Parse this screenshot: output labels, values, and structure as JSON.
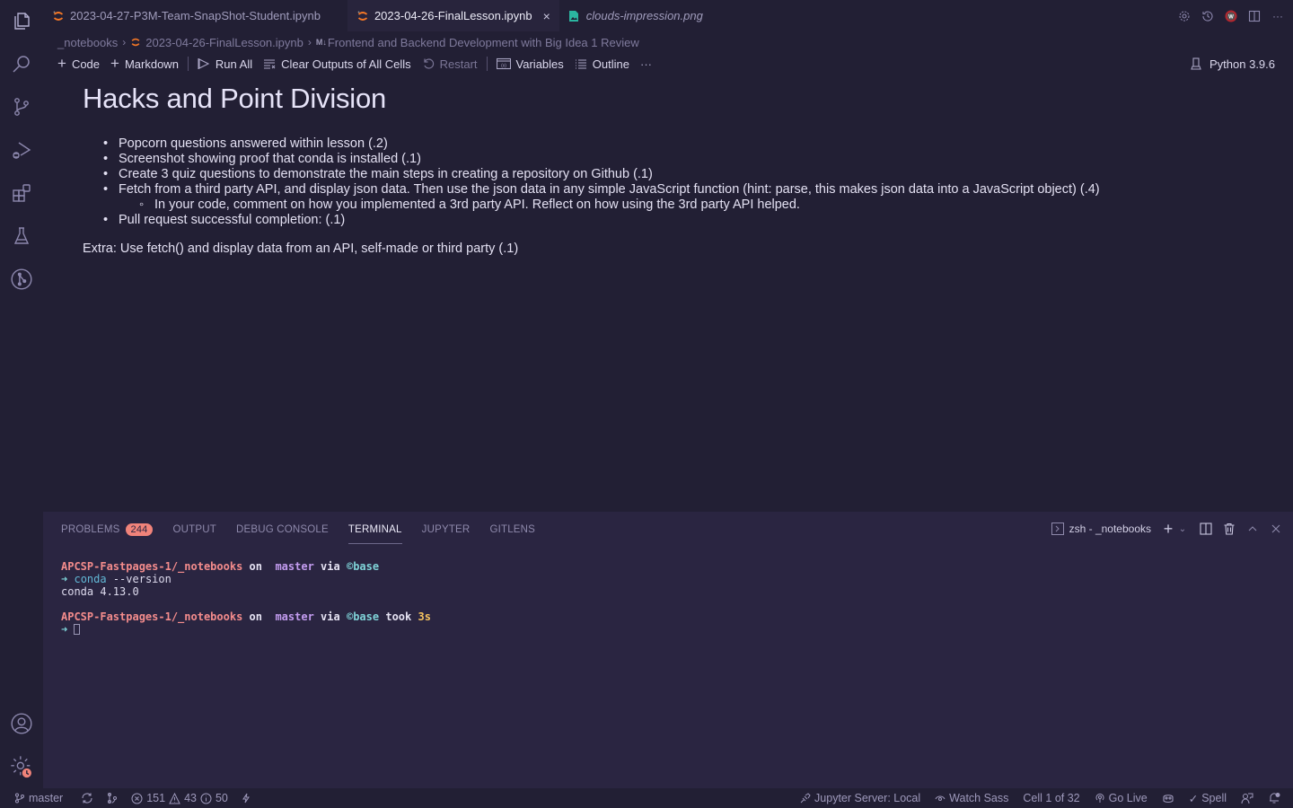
{
  "tabs": [
    {
      "label": "2023-04-27-P3M-Team-SnapShot-Student.ipynb",
      "icon": "jupyter-icon",
      "active": false
    },
    {
      "label": "2023-04-26-FinalLesson.ipynb",
      "icon": "jupyter-icon",
      "active": true,
      "close": "×"
    },
    {
      "label": "clouds-impression.png",
      "icon": "image-file-icon",
      "active": false
    }
  ],
  "breadcrumb": {
    "folder": "_notebooks",
    "file": "2023-04-26-FinalLesson.ipynb",
    "md_tag": "M↓",
    "section": "Frontend and Backend Development with Big Idea 1 Review"
  },
  "toolbar": {
    "code": "Code",
    "markdown": "Markdown",
    "run_all": "Run All",
    "clear_outputs": "Clear Outputs of All Cells",
    "restart": "Restart",
    "variables": "Variables",
    "outline": "Outline",
    "more": "···",
    "kernel": "Python 3.9.6"
  },
  "notebook": {
    "heading": "Hacks and Point Division",
    "items": [
      "Popcorn questions answered within lesson (.2)",
      "Screenshot showing proof that conda is installed (.1)",
      "Create 3 quiz questions to demonstrate the main steps in creating a repository on Github (.1)",
      "Fetch from a third party API, and display json data. Then use the json data in any simple JavaScript function (hint: parse, this makes json data into a JavaScript object) (.4)",
      "Pull request successful completion: (.1)"
    ],
    "subitem": "In your code, comment on how you implemented a 3rd party API. Reflect on how using the 3rd party API helped.",
    "extra": "Extra: Use fetch() and display data from an API, self-made or third party (.1)"
  },
  "panel": {
    "tabs": [
      "PROBLEMS",
      "OUTPUT",
      "DEBUG CONSOLE",
      "TERMINAL",
      "JUPYTER",
      "GITLENS"
    ],
    "problems_count": "244",
    "active_tab": "TERMINAL",
    "terminal_name": "zsh - _notebooks"
  },
  "terminal": {
    "path": "APCSP-Fastpages-1/_notebooks",
    "on": "on",
    "branch_glyph": "",
    "branch": "master",
    "via": "via",
    "env_glyph": "©",
    "env": "base",
    "arrow": "➜",
    "cmd": "conda",
    "args": " --version",
    "output": "conda 4.13.0",
    "took": "took",
    "duration": "3s"
  },
  "statusbar": {
    "branch": "master",
    "errors": "151",
    "warnings": "43",
    "infos": "50",
    "jupyter_server": "Jupyter Server: Local",
    "watch_sass": "Watch Sass",
    "cell": "Cell 1 of 32",
    "go_live": "Go Live",
    "spell": "Spell"
  },
  "colors": {
    "background": "#221f34",
    "panel": "#2a2541",
    "badge": "#f0837a",
    "accent_orange": "#f37726",
    "image_icon": "#2bb5a0"
  }
}
